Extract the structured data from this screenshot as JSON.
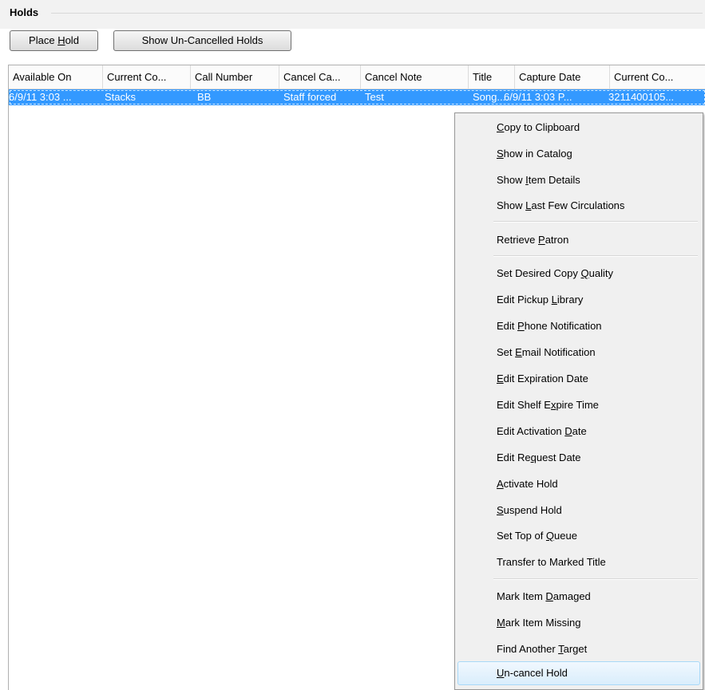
{
  "section": {
    "title": "Holds"
  },
  "toolbar": {
    "place_hold": {
      "pre": "Place ",
      "key": "H",
      "post": "old"
    },
    "show_uncancelled": "Show Un-Cancelled Holds"
  },
  "grid": {
    "columns": [
      "Available On",
      "Current Co...",
      "Call Number",
      "Cancel Ca...",
      "Cancel Note",
      "Title",
      "Capture Date",
      "Current Co..."
    ],
    "rows": [
      [
        "6/9/11 3:03 ...",
        "Stacks",
        "BB",
        "Staff forced",
        "Test",
        "Song...",
        "6/9/11 3:03 P...",
        "3211400105..."
      ]
    ]
  },
  "context_menu": {
    "items": [
      {
        "pre": "",
        "key": "C",
        "post": "opy to Clipboard"
      },
      {
        "pre": "",
        "key": "S",
        "post": "how in Catalog"
      },
      {
        "pre": "Show ",
        "key": "I",
        "post": "tem Details"
      },
      {
        "pre": "Show ",
        "key": "L",
        "post": "ast Few Circulations"
      },
      {
        "pre": "Retrieve ",
        "key": "P",
        "post": "atron"
      },
      {
        "pre": "Set Desired Copy ",
        "key": "Q",
        "post": "uality"
      },
      {
        "pre": "Edit Pickup ",
        "key": "L",
        "post": "ibrary"
      },
      {
        "pre": "Edit ",
        "key": "P",
        "post": "hone Notification"
      },
      {
        "pre": "Set ",
        "key": "E",
        "post": "mail Notification"
      },
      {
        "pre": "",
        "key": "E",
        "post": "dit Expiration Date"
      },
      {
        "pre": "Edit Shelf E",
        "key": "x",
        "post": "pire Time"
      },
      {
        "pre": "Edit Activation ",
        "key": "D",
        "post": "ate"
      },
      {
        "pre": "Edit Re",
        "key": "q",
        "post": "uest Date"
      },
      {
        "pre": "",
        "key": "A",
        "post": "ctivate Hold"
      },
      {
        "pre": "",
        "key": "S",
        "post": "uspend Hold"
      },
      {
        "pre": "Set Top of ",
        "key": "Q",
        "post": "ueue"
      },
      {
        "pre": "Transfer to Marked Title",
        "key": "",
        "post": ""
      },
      {
        "pre": "Mark Item ",
        "key": "D",
        "post": "amaged"
      },
      {
        "pre": "",
        "key": "M",
        "post": "ark Item Missing"
      },
      {
        "pre": "Find Another ",
        "key": "T",
        "post": "arget"
      },
      {
        "pre": "",
        "key": "U",
        "post": "n-cancel Hold"
      }
    ]
  },
  "colors": {
    "selection": "#3399ff",
    "menu_bg": "#f0f0f0",
    "menu_hover": "#d9edfc"
  }
}
